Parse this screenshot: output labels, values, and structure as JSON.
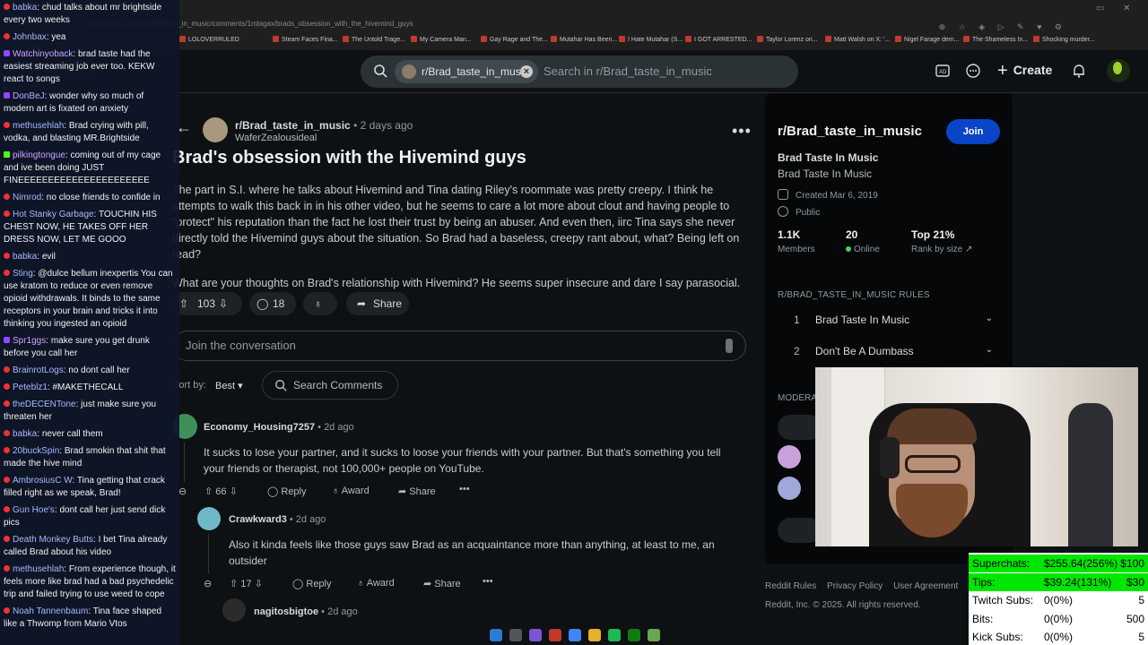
{
  "browser": {
    "url": "www.reddit.com/r/Brad_taste_in_music/comments/1mbigax/brads_obsession_with_the_hivemind_guys",
    "bookmarks": [
      "LOLOVERRULED",
      "Steam Faces Fina...",
      "The Untold Trage...",
      "My Camera Man...",
      "Gay Rage and The...",
      "Mutahar Has Been...",
      "I Hate Mutahar (S...",
      "I GOT ARRESTED...",
      "Taylor Lorenz on...",
      "Matt Walsh on X: '...",
      "Nigel Farage dem...",
      "The Shameless In...",
      "Shocking murder..."
    ]
  },
  "header": {
    "search_chip": "r/Brad_taste_in_music",
    "search_placeholder": "Search in r/Brad_taste_in_music",
    "create_label": "Create"
  },
  "post": {
    "subreddit": "r/Brad_taste_in_music",
    "time": "• 2 days ago",
    "author": "WaferZealousideal",
    "title": "Brad's obsession with the Hivemind guys",
    "body1": "The part in S.I. where he talks about Hivemind and Tina dating Riley's roommate was pretty creepy. I think he attempts to walk this back in in his other video, but he seems to care a lot more about clout and having people to \"protect\" his reputation than the fact he lost their trust by being an abuser. And even then, iirc Tina says she never directly told the Hivemind guys about the situation. So Brad had a baseless, creepy rant about, what? Being left on read?",
    "body2": "What are your thoughts on Brad's relationship with Hivemind? He seems super insecure and dare I say parasocial.",
    "votes": "103",
    "comments": "18",
    "share": "Share"
  },
  "comments_ui": {
    "join_placeholder": "Join the conversation",
    "sort_label": "Sort by:",
    "sort_value": "Best",
    "search_comments": "Search Comments"
  },
  "comments": [
    {
      "user": "Economy_Housing7257",
      "time": "• 2d ago",
      "text": "It sucks to lose your partner, and it sucks to loose your friends with your partner. But that's something you tell your friends or therapist, not 100,000+ people on YouTube.",
      "votes": "66",
      "reply": "Reply",
      "award": "Award",
      "share": "Share"
    },
    {
      "user": "Crawkward3",
      "time": "• 2d ago",
      "text": "Also it kinda feels like those guys saw Brad as an acquaintance more than anything, at least to me, an outsider",
      "votes": "17",
      "reply": "Reply",
      "award": "Award",
      "share": "Share"
    },
    {
      "user": "nagitosbigtoe",
      "time": "• 2d ago"
    }
  ],
  "sidebar": {
    "name": "r/Brad_taste_in_music",
    "join": "Join",
    "title": "Brad Taste In Music",
    "subtitle": "Brad Taste In Music",
    "created": "Created Mar 6, 2019",
    "visibility": "Public",
    "members_v": "1.1K",
    "members_l": "Members",
    "online_v": "20",
    "online_l": "Online",
    "rank_v": "Top 21%",
    "rank_l": "Rank by size",
    "rules_h": "R/BRAD_TASTE_IN_MUSIC RULES",
    "rules": [
      {
        "n": "1",
        "t": "Brad Taste In Music"
      },
      {
        "n": "2",
        "t": "Don't Be A Dumbass"
      }
    ],
    "mod_h": "MODERA"
  },
  "footer": {
    "links": [
      "Reddit Rules",
      "Privacy Policy",
      "User Agreement",
      "Ac"
    ],
    "copyright": "Reddit, Inc. © 2025. All rights reserved."
  },
  "chat": [
    {
      "p": "yt",
      "u": "babka",
      "m": "chud talks about mr brightside every two weeks"
    },
    {
      "p": "yt",
      "u": "Johnbax",
      "m": "yea"
    },
    {
      "p": "tw",
      "u": "Watchinyoback",
      "m": "brad taste had the easiest streaming job ever too. KEKW react to songs"
    },
    {
      "p": "tw",
      "u": "DonBeJ",
      "m": "wonder why so much of modern art is fixated on anxiety"
    },
    {
      "p": "yt",
      "u": "methusehlah",
      "m": "Brad crying with pill, vodka, and blasting MR.Brightside"
    },
    {
      "p": "tw",
      "u": "Watchinyoback",
      "m": "coming out of my cage and ive been doing JUST FINEEEEEEEEEEEEEEEEEEEEEE",
      "kick": "pilkingtongue"
    },
    {
      "p": "yt",
      "u": "Nimrod",
      "m": "no close friends to confide in"
    },
    {
      "p": "yt",
      "u": "Hot Stanky Garbage",
      "m": "TOUCHIN HIS CHEST NOW, HE TAKES OFF HER DRESS NOW, LET ME GOOO"
    },
    {
      "p": "yt",
      "u": "babka",
      "m": "evil"
    },
    {
      "p": "yt",
      "u": "Sting",
      "m": "@dulce bellum inexpertis You can use kratom to reduce or even remove opioid withdrawals. It binds to the same receptors in your brain and tricks it into thinking you ingested an opioid"
    },
    {
      "p": "tw",
      "u": "Spr1ggs",
      "m": "make sure you get drunk before you call her"
    },
    {
      "p": "yt",
      "u": "BrainrotLogs",
      "m": "no dont call her"
    },
    {
      "p": "yt",
      "u": "Peteblz1",
      "m": "#MAKETHECALL"
    },
    {
      "p": "yt",
      "u": "theDECENTone",
      "m": "just make sure you threaten her"
    },
    {
      "p": "yt",
      "u": "babka",
      "m": "never call them"
    },
    {
      "p": "yt",
      "u": "20buckSpin",
      "m": "Brad smokin that shit that made the hive mind"
    },
    {
      "p": "yt",
      "u": "AmbrosiusC W",
      "m": "Tina getting that crack filled right as we speak, Brad!"
    },
    {
      "p": "yt",
      "u": "Gun Hoe's",
      "m": "dont call her just send dick pics"
    },
    {
      "p": "yt",
      "u": "Death Monkey Butts",
      "m": "I bet Tina already called Brad about his video"
    },
    {
      "p": "yt",
      "u": "methusehlah",
      "m": "From experience though, it feels more like brad had a bad psychedelic trip and failed trying to use weed to cope"
    },
    {
      "p": "yt",
      "u": "Noah Tannenbaum",
      "m": "Tina face shaped like a Thwomp from Mario Vtos"
    }
  ],
  "donations": [
    {
      "l": "Superchats:",
      "m": "$255.64(256%)",
      "r": "$100",
      "hl": true
    },
    {
      "l": "Tips:",
      "m": "$39.24(131%)",
      "r": "$30",
      "hl": true
    },
    {
      "l": "Twitch Subs:",
      "m": "0(0%)",
      "r": "5",
      "hl": false
    },
    {
      "l": "Bits:",
      "m": "0(0%)",
      "r": "500",
      "hl": false
    },
    {
      "l": "Kick Subs:",
      "m": "0(0%)",
      "r": "5",
      "hl": false
    }
  ]
}
